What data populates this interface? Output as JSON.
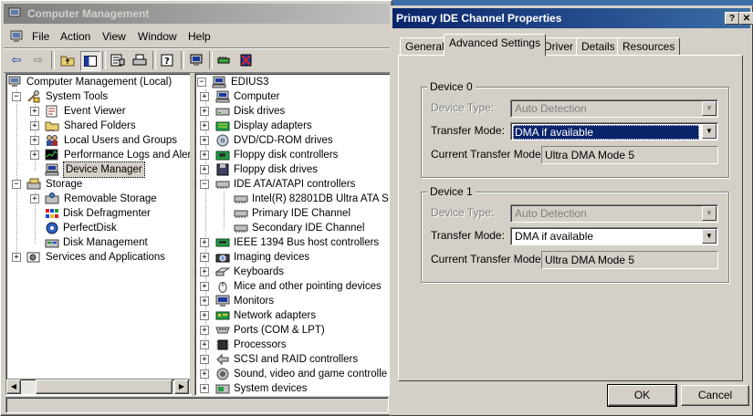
{
  "cm": {
    "title": "Computer Management",
    "menu": [
      "File",
      "Action",
      "View",
      "Window",
      "Help"
    ]
  },
  "left_tree": [
    {
      "label": "Computer Management (Local)",
      "icon": "computer-management-icon"
    },
    {
      "label": "System Tools",
      "icon": "system-tools-icon"
    },
    {
      "label": "Event Viewer",
      "icon": "event-viewer-icon"
    },
    {
      "label": "Shared Folders",
      "icon": "shared-folders-icon"
    },
    {
      "label": "Local Users and Groups",
      "icon": "users-icon"
    },
    {
      "label": "Performance Logs and Alerts",
      "icon": "performance-icon"
    },
    {
      "label": "Device Manager",
      "icon": "device-manager-icon"
    },
    {
      "label": "Storage",
      "icon": "storage-icon"
    },
    {
      "label": "Removable Storage",
      "icon": "removable-storage-icon"
    },
    {
      "label": "Disk Defragmenter",
      "icon": "defrag-icon"
    },
    {
      "label": "PerfectDisk",
      "icon": "perfectdisk-icon"
    },
    {
      "label": "Disk Management",
      "icon": "disk-management-icon"
    },
    {
      "label": "Services and Applications",
      "icon": "services-icon"
    }
  ],
  "right_tree": [
    {
      "label": "EDIUS3",
      "icon": "computer-icon"
    },
    {
      "label": "Computer",
      "icon": "computer-icon"
    },
    {
      "label": "Disk drives",
      "icon": "disk-drive-icon"
    },
    {
      "label": "Display adapters",
      "icon": "display-icon"
    },
    {
      "label": "DVD/CD-ROM drives",
      "icon": "cdrom-icon"
    },
    {
      "label": "Floppy disk controllers",
      "icon": "floppy-controller-icon"
    },
    {
      "label": "Floppy disk drives",
      "icon": "floppy-icon"
    },
    {
      "label": "IDE ATA/ATAPI controllers",
      "icon": "ide-controller-icon"
    },
    {
      "label": "Intel(R) 82801DB Ultra ATA S",
      "icon": "ide-controller-icon"
    },
    {
      "label": "Primary IDE Channel",
      "icon": "ide-controller-icon"
    },
    {
      "label": "Secondary IDE Channel",
      "icon": "ide-controller-icon"
    },
    {
      "label": "IEEE 1394 Bus host controllers",
      "icon": "firewire-icon"
    },
    {
      "label": "Imaging devices",
      "icon": "camera-icon"
    },
    {
      "label": "Keyboards",
      "icon": "keyboard-icon"
    },
    {
      "label": "Mice and other pointing devices",
      "icon": "mouse-icon"
    },
    {
      "label": "Monitors",
      "icon": "monitor-icon"
    },
    {
      "label": "Network adapters",
      "icon": "network-icon"
    },
    {
      "label": "Ports (COM & LPT)",
      "icon": "port-icon"
    },
    {
      "label": "Processors",
      "icon": "processor-icon"
    },
    {
      "label": "SCSI and RAID controllers",
      "icon": "scsi-icon"
    },
    {
      "label": "Sound, video and game controlle",
      "icon": "sound-icon"
    },
    {
      "label": "System devices",
      "icon": "system-device-icon"
    }
  ],
  "dialog": {
    "title": "Primary IDE Channel Properties",
    "help_btn": "?",
    "close_btn": "X",
    "tabs": [
      "General",
      "Advanced Settings",
      "Driver",
      "Details",
      "Resources"
    ],
    "device0": {
      "legend": "Device 0",
      "device_type_label": "Device Type:",
      "device_type_value": "Auto Detection",
      "transfer_mode_label": "Transfer Mode:",
      "transfer_mode_value": "DMA if available",
      "current_mode_label": "Current Transfer Mode:",
      "current_mode_value": "Ultra DMA Mode 5"
    },
    "device1": {
      "legend": "Device 1",
      "device_type_label": "Device Type:",
      "device_type_value": "Auto Detection",
      "transfer_mode_label": "Transfer Mode:",
      "transfer_mode_value": "DMA if available",
      "current_mode_label": "Current Transfer Mode:",
      "current_mode_value": "Ultra DMA Mode 5"
    },
    "ok": "OK",
    "cancel": "Cancel"
  }
}
